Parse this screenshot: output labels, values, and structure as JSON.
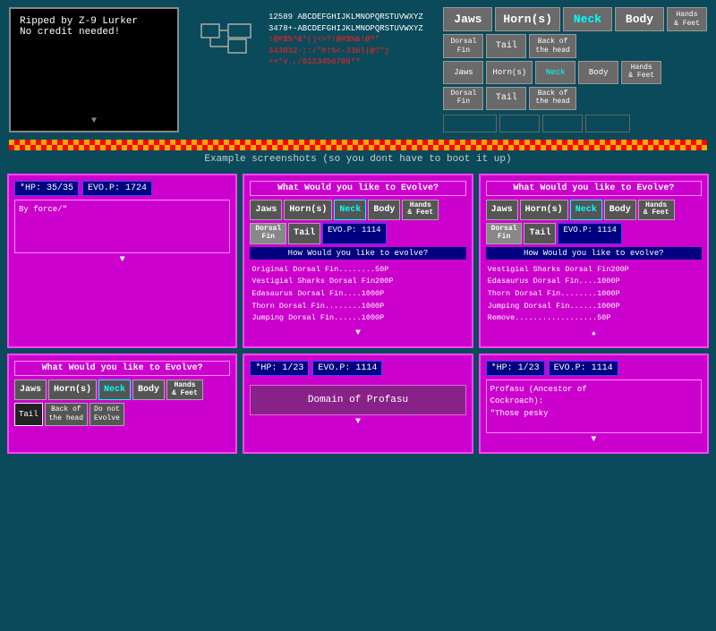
{
  "credit": {
    "line1": "Ripped by Z-9 Lurker",
    "line2": "No credit needed!"
  },
  "top_buttons_row1": [
    "Jaws",
    "Horn(s)",
    "Neck",
    "Body",
    "Hands\n& Feet"
  ],
  "top_buttons_row2": [
    "Dorsal\nFin",
    "Tail",
    "Back of\nthe head"
  ],
  "top_buttons_row2b": [
    "Jaws",
    "Horn(s)",
    "Neck",
    "Body",
    "Hands\n& Feet"
  ],
  "top_buttons_row3": [
    "Dorsal\nFin",
    "Tail",
    "Back of\nthe head"
  ],
  "font_lines": [
    "12589 ABCDEFGHIJKLMNOPQRSTUVWXYZ",
    "3478+-ABCDEFGHIJKLMNOPQRSTUVWXYZ",
    "!@#$%^&*()<>?!@#$%&!@?\"",
    "343832-;:/\"#!%<-336l|@?\"j",
    "++*v.,/0123456789**"
  ],
  "example_text": "Example screenshots (so you dont have to boot it up)",
  "panel1": {
    "hp": "*HP: 35/35",
    "evo": "EVO.P:  1724",
    "text": "By force/\"",
    "arrow": "▼"
  },
  "panel2": {
    "title": "What Would you like to Evolve?",
    "bp_btns": [
      "Jaws",
      "Horn(s)",
      "Neck",
      "Body",
      "Hands\n& Feet"
    ],
    "row2_btns": [
      "Dorsal\nFin",
      "Tail",
      "EVO.P:   1114"
    ],
    "sub": "How Would you like to evolve?",
    "options": [
      "Original Dorsal Fin........50P",
      "Vestigial Sharks Dorsal Fin200P",
      "Edasaurus Dorsal Fin....1000P",
      "Thorn Dorsal Fin........1000P",
      "Jumping Dorsal Fin......1000P"
    ],
    "arrow": "▼"
  },
  "panel3": {
    "title": "What Would you like to Evolve?",
    "bp_btns": [
      "Jaws",
      "Horn(s)",
      "Neck",
      "Body",
      "Hands\n& Feet"
    ],
    "row2_btns": [
      "Dorsal\nFin",
      "Tail",
      "EVO.P:   1114"
    ],
    "sub": "How Would you like to evolve?",
    "options": [
      "Vestigial Sharks Dorsal Fin200P",
      "Edasaurus Dorsal Fin....1000P",
      "Thorn Dorsal Fin........1000P",
      "Jumping Dorsal Fin......1000P",
      "Remove..................50P"
    ],
    "arrow": "★"
  },
  "panel4": {
    "title": "What Would you like to Evolve?",
    "bp_btns": [
      "Jaws",
      "Horn(s)",
      "Neck",
      "Body",
      "Hands\n& Feet"
    ],
    "row2_btns": [
      "Tail",
      "Back of\nthe head",
      "Do not\nEvolve"
    ],
    "selected_active": "Tail"
  },
  "panel5": {
    "hp": "*HP:  1/23",
    "evo": "EVO.P:  1114",
    "domain": "Domain of Profasu",
    "arrow": "▼"
  },
  "panel6": {
    "hp": "*HP:  1/23",
    "evo": "EVO.P:  1114",
    "text_title": "Profasu (Ancestor of\nCockroach):",
    "text_body": "\"Those pesky",
    "arrow": "▼"
  }
}
